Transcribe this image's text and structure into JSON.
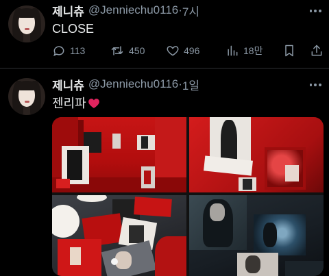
{
  "tweets": [
    {
      "name": "제니츄",
      "handle": "@Jenniechu0116",
      "separator": "·",
      "time": "7시",
      "text": "CLOSE",
      "stats": {
        "replies": "113",
        "retweets": "450",
        "likes": "496",
        "views": "18만"
      }
    },
    {
      "name": "제니츄",
      "handle": "@Jenniechu0116",
      "separator": "·",
      "time": "1일",
      "text": "젠리파"
    }
  ],
  "icons": {
    "reply": "reply-icon",
    "retweet": "retweet-icon",
    "like": "heart-icon",
    "views": "views-icon",
    "bookmark": "bookmark-icon",
    "share": "share-icon",
    "more": "more-icon",
    "emoji": "red-heart-emoji"
  },
  "colors": {
    "background": "#000000",
    "text": "#e7e9ea",
    "muted": "#8b98a5",
    "divider": "#2f3336",
    "emoji_red": "#e0245e"
  }
}
